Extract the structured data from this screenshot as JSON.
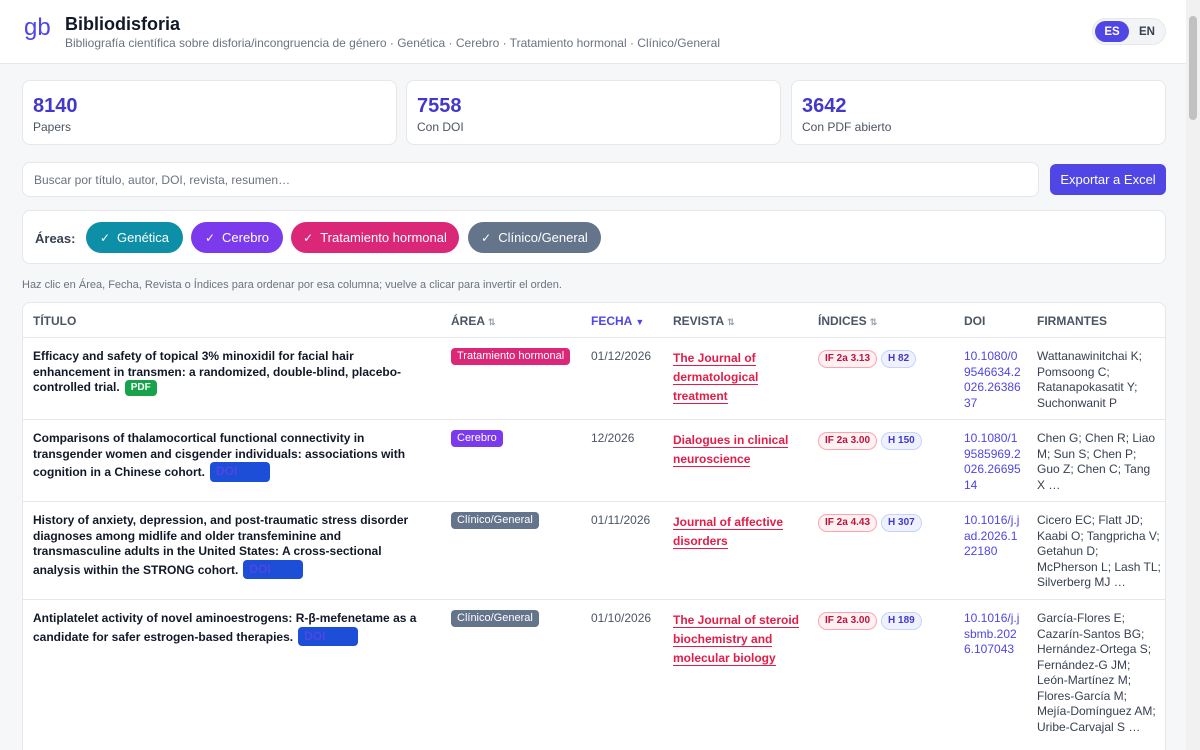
{
  "app": {
    "title": "Bibliodisforia",
    "subtitle": "Bibliografía científica sobre disforia/incongruencia de género · Genética · Cerebro · Tratamiento hormonal · Clínico/General",
    "logo_letters": "gb",
    "languages": [
      "ES",
      "EN"
    ],
    "active_language": "ES"
  },
  "stats": [
    {
      "value": "8140",
      "label": "Papers"
    },
    {
      "value": "7558",
      "label": "Con DOI"
    },
    {
      "value": "3642",
      "label": "Con PDF abierto"
    }
  ],
  "search": {
    "placeholder": "Buscar por título, autor, DOI, revista, resumen…",
    "value": ""
  },
  "export_label": "Exportar a Excel",
  "areas": {
    "label": "Áreas:",
    "chips": [
      {
        "label": "Genética",
        "color": "#0e8fa8"
      },
      {
        "label": "Cerebro",
        "color": "#7c3aed"
      },
      {
        "label": "Tratamiento hormonal",
        "color": "#db2777"
      },
      {
        "label": "Clínico/General",
        "color": "#64748b"
      }
    ]
  },
  "hint": "Haz clic en Área, Fecha, Revista o Índices para ordenar por esa columna; vuelve a clicar para invertir el orden.",
  "table": {
    "columns": [
      "TÍTULO",
      "ÁREA",
      "FECHA",
      "REVISTA",
      "ÍNDICES",
      "DOI",
      "FIRMANTES"
    ],
    "sort_icon": "⇅",
    "active_sort_icon": "▼",
    "rows": [
      {
        "title": "Efficacy and safety of topical 3% minoxidil for facial hair enhancement in transmen: a randomized, double-blind, placebo-controlled trial.",
        "tag": "PDF",
        "area": "Tratamiento hormonal",
        "area_color": "#db2777",
        "date": "01/12/2026",
        "journal": "The Journal of dermatological treatment",
        "if": "IF 2a 3.13",
        "h": "H 82",
        "doi": "10.1080/09546634.2026.2638637",
        "authors": "Wattanawinitchai K; Pomsoong C; Ratanapokasatit Y; Suchonwanit P"
      },
      {
        "title": "Comparisons of thalamocortical functional connectivity in transgender women and cisgender individuals: associations with cognition in a Chinese cohort.",
        "tag": "DOI",
        "area": "Cerebro",
        "area_color": "#7c3aed",
        "date": "12/2026",
        "journal": "Dialogues in clinical neuroscience",
        "if": "IF 2a 3.00",
        "h": "H 150",
        "doi": "10.1080/19585969.2026.2669514",
        "authors": "Chen G; Chen R; Liao M; Sun S; Chen P; Guo Z; Chen C; Tang X …"
      },
      {
        "title": "History of anxiety, depression, and post-traumatic stress disorder diagnoses among midlife and older transfeminine and transmasculine adults in the United States: A cross-sectional analysis within the STRONG cohort.",
        "tag": "DOI",
        "area": "Clínico/General",
        "area_color": "#64748b",
        "date": "01/11/2026",
        "journal": "Journal of affective disorders",
        "if": "IF 2a 4.43",
        "h": "H 307",
        "doi": "10.1016/j.jad.2026.122180",
        "authors": "Cicero EC; Flatt JD; Kaabi O; Tangpricha V; Getahun D; McPherson L; Lash TL; Silverberg MJ …"
      },
      {
        "title": "Antiplatelet activity of novel aminoestrogens: R-β-mefenetame as a candidate for safer estrogen-based therapies.",
        "tag": "DOI",
        "area": "Clínico/General",
        "area_color": "#64748b",
        "date": "01/10/2026",
        "journal": "The Journal of steroid biochemistry and molecular biology",
        "if": "IF 2a 3.00",
        "h": "H 189",
        "doi": "10.1016/j.jsbmb.2026.107043",
        "authors": "García-Flores E; Cazarín-Santos BG; Hernández-Ortega S; Fernández-G JM; León-Martínez M; Flores-García M; Mejía-Domínguez AM; Uribe-Carvajal S …"
      }
    ]
  }
}
